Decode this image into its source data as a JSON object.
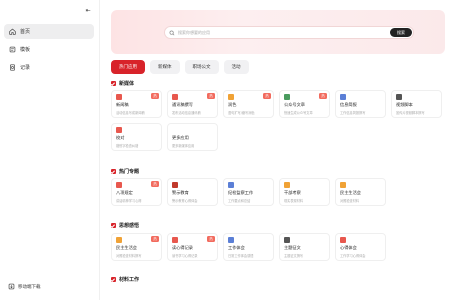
{
  "sidebar": {
    "collapse_glyph": "⇤",
    "items": [
      {
        "label": "首页",
        "icon": "home-icon",
        "active": true
      },
      {
        "label": "模板",
        "icon": "template-icon",
        "active": false
      },
      {
        "label": "记录",
        "icon": "record-icon",
        "active": false
      }
    ],
    "mobile_download": "移动端下载"
  },
  "search": {
    "placeholder": "搜索你想要的应用",
    "button": "搜索"
  },
  "tabs": [
    {
      "label": "热门应用",
      "active": true
    },
    {
      "label": "新媒体",
      "active": false
    },
    {
      "label": "职场公文",
      "active": false
    },
    {
      "label": "活动",
      "active": false
    }
  ],
  "badge_text": "热",
  "colors": {
    "accent": "#d8232a",
    "badge": "#f26b5e"
  },
  "sections": [
    {
      "title": "新媒体",
      "cards": [
        {
          "title": "新闻稿",
          "desc": "活动信息写成新闻稿",
          "icon": "pen-icon",
          "color": "#e8584e",
          "badge": true
        },
        {
          "title": "通讯稿撰写",
          "desc": "发布活动信息通讯稿",
          "icon": "edit-icon",
          "color": "#e8584e",
          "badge": true
        },
        {
          "title": "润色",
          "desc": "语句扩写/缩写润色",
          "icon": "brush-icon",
          "color": "#f0a236",
          "badge": true
        },
        {
          "title": "公众号文章",
          "desc": "快速生成公众号文章",
          "icon": "book-icon",
          "color": "#4a9b5e",
          "badge": true
        },
        {
          "title": "信息简报",
          "desc": "工作信息简报撰写",
          "icon": "doc-icon",
          "color": "#5b7fd6",
          "badge": false
        },
        {
          "title": "视频脚本",
          "desc": "宣传片视频脚本撰写",
          "icon": "film-icon",
          "color": "#555555",
          "badge": false
        },
        {
          "title": "校对",
          "desc": "错别字检查纠错",
          "icon": "pin-icon",
          "color": "#e8584e",
          "badge": false
        },
        {
          "title": "更多应用",
          "desc": "更多新媒体应用",
          "icon": "more-icon",
          "color": "#ffffff",
          "badge": false
        }
      ]
    },
    {
      "title": "热门专题",
      "cards": [
        {
          "title": "八项规定",
          "desc": "讲话精神学习心得",
          "icon": "pen-icon",
          "color": "#e8584e",
          "badge": true
        },
        {
          "title": "警示教育",
          "desc": "警示教育心得体会",
          "icon": "book-icon",
          "color": "#c0392b",
          "badge": false
        },
        {
          "title": "纪检监察工作",
          "desc": "工作要点和总结",
          "icon": "doc-icon",
          "color": "#5b7fd6",
          "badge": false
        },
        {
          "title": "干部考察",
          "desc": "现实表现材料",
          "icon": "edit-icon",
          "color": "#f0a236",
          "badge": false
        },
        {
          "title": "民主生活会",
          "desc": "对照检查材料",
          "icon": "edit-icon",
          "color": "#f0a236",
          "badge": false
        }
      ]
    },
    {
      "title": "思想感悟",
      "cards": [
        {
          "title": "民主生活会",
          "desc": "对照检查材料撰写",
          "icon": "edit-icon",
          "color": "#f0a236",
          "badge": true
        },
        {
          "title": "读心得记录",
          "desc": "读书学习心得记录",
          "icon": "tag-icon",
          "color": "#e8584e",
          "badge": true
        },
        {
          "title": "工作体会",
          "desc": "日常工作体会感悟",
          "icon": "doc-icon",
          "color": "#5b7fd6",
          "badge": false
        },
        {
          "title": "主题征文",
          "desc": "主题征文撰写",
          "icon": "film-icon",
          "color": "#555555",
          "badge": false
        },
        {
          "title": "心得体会",
          "desc": "工作学习心得体会",
          "icon": "heart-icon",
          "color": "#e8584e",
          "badge": false
        }
      ]
    },
    {
      "title": "材料工作",
      "cards": []
    }
  ]
}
